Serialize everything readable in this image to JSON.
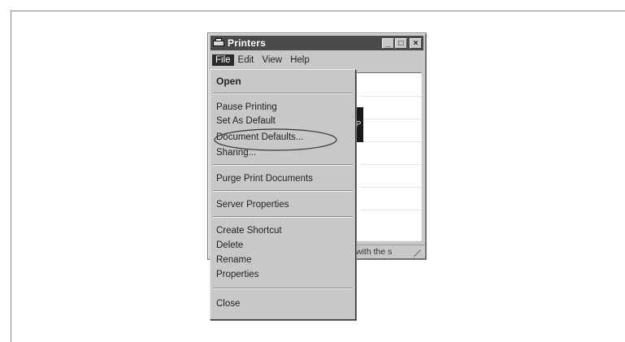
{
  "window": {
    "title": "Printers",
    "controls": [
      "minimize-icon",
      "maximize-icon",
      "close-icon"
    ]
  },
  "menubar": {
    "items": [
      "File",
      "Edit",
      "View",
      "Help"
    ]
  },
  "dropdown": {
    "items": [
      {
        "label": "Open"
      },
      {
        "label": "Pause Printing"
      },
      {
        "label": "Set As Default"
      },
      {
        "label": "Document Defaults..."
      },
      {
        "label": "Sharing..."
      },
      {
        "label": "Purge Print Documents"
      },
      {
        "label": "Server Properties"
      },
      {
        "label": "Create Shortcut"
      },
      {
        "label": "Delete"
      },
      {
        "label": "Rename"
      },
      {
        "label": "Properties"
      },
      {
        "label": "Close"
      }
    ]
  },
  "client": {
    "tab_letter": "P",
    "status_text": "with the s"
  }
}
